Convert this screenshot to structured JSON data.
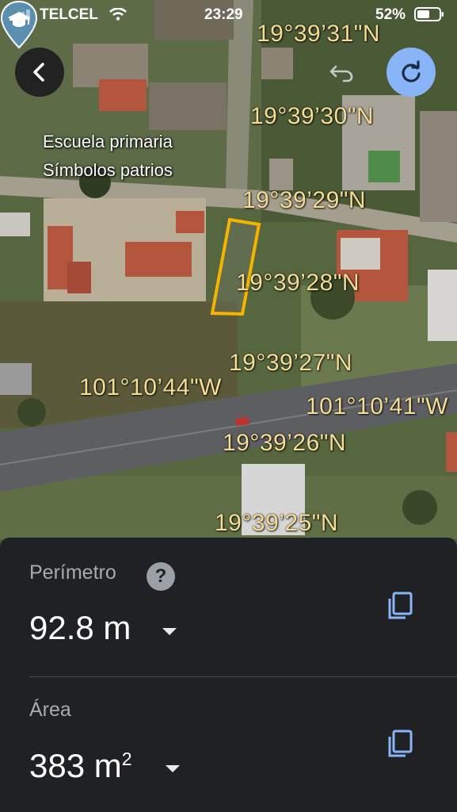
{
  "status_bar": {
    "carrier": "TELCEL",
    "time": "23:29",
    "battery": "52%"
  },
  "map": {
    "poi": {
      "line1": "Escuela primaria",
      "line2": "Símbolos patrios",
      "icon": "school-icon"
    },
    "latitude_labels": [
      "19°39’31\"N",
      "19°39’30\"N",
      "19°39’29\"N",
      "19°39’28\"N",
      "19°39’27\"N",
      "19°39’26\"N",
      "19°39’25\"N"
    ],
    "longitude_labels": [
      "101°10’44\"W",
      "101°10’41\"W"
    ],
    "outline_color": "#f4b400"
  },
  "controls": {
    "back": "chevron-left-icon",
    "undo": "undo-icon",
    "redo": "redo-icon",
    "redo_color": "#8ab4f8"
  },
  "measurements": {
    "perimeter": {
      "label": "Perímetro",
      "value": "92.8 m"
    },
    "area": {
      "label": "Área",
      "value": "383 m",
      "unit_sup": "2"
    }
  }
}
